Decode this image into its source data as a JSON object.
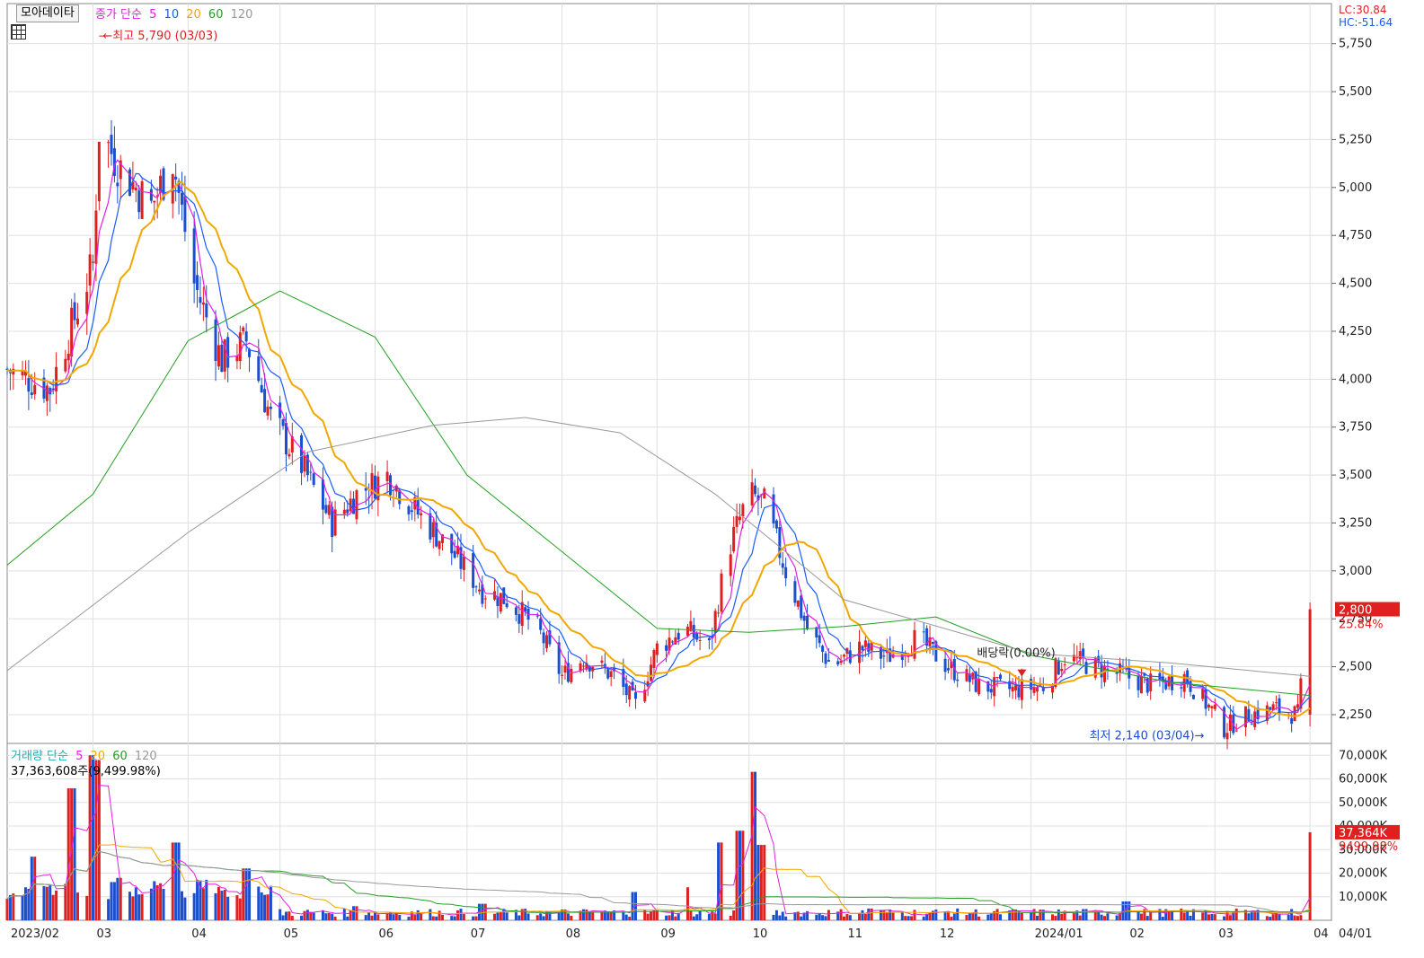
{
  "toolbar": {
    "button_label": "모아데이타"
  },
  "legend_top": {
    "label": "종가 단순",
    "periods": [
      "5",
      "10",
      "20",
      "60",
      "120"
    ]
  },
  "legend_bottom": {
    "label": "거래량 단순",
    "periods": [
      "5",
      "20",
      "60",
      "120"
    ],
    "info": "37,363,608주(9,499.98%)"
  },
  "top_right": {
    "lc": "LC:30.84",
    "hc": "HC:-51.64"
  },
  "colors": {
    "ma5": "#e020e0",
    "ma10": "#1a5cff",
    "ma20": "#f0a800",
    "ma60": "#22a022",
    "ma120": "#999999",
    "up": "#e02020",
    "down": "#1a4fd0",
    "grid": "#e0e0e0"
  },
  "chart_data": [
    {
      "type": "candlestick",
      "title": "",
      "x_tick_labels": [
        "2023/02",
        "03",
        "04",
        "05",
        "06",
        "07",
        "08",
        "09",
        "10",
        "11",
        "12",
        "2024/01",
        "02",
        "03",
        "04",
        "04/01"
      ],
      "y_tick_labels": [
        "2,250",
        "2,500",
        "2,750",
        "3,000",
        "3,250",
        "3,500",
        "3,750",
        "4,000",
        "4,250",
        "4,500",
        "4,750",
        "5,000",
        "5,250",
        "5,500",
        "5,750"
      ],
      "ylim": [
        2100,
        5800
      ],
      "annotations": {
        "high": "최고 5,790 (03/03)",
        "low": "최저 2,140 (03/04)",
        "dividend": "배당락(0.00%)",
        "last_price": "2,800",
        "last_change": "25.84%"
      },
      "close_series": [
        [
          "2023-02-01",
          4050
        ],
        [
          "2023-02-15",
          3950
        ],
        [
          "2023-03-01",
          4600
        ],
        [
          "2023-03-03",
          5300
        ],
        [
          "2023-03-10",
          5100
        ],
        [
          "2023-03-20",
          4900
        ],
        [
          "2023-03-27",
          5150
        ],
        [
          "2023-04-03",
          4500
        ],
        [
          "2023-04-12",
          4100
        ],
        [
          "2023-04-20",
          4200
        ],
        [
          "2023-04-28",
          3800
        ],
        [
          "2023-05-08",
          3550
        ],
        [
          "2023-05-18",
          3250
        ],
        [
          "2023-05-26",
          3400
        ],
        [
          "2023-06-05",
          3500
        ],
        [
          "2023-06-15",
          3300
        ],
        [
          "2023-06-26",
          3100
        ],
        [
          "2023-07-06",
          2900
        ],
        [
          "2023-07-14",
          2850
        ],
        [
          "2023-07-24",
          2700
        ],
        [
          "2023-08-01",
          2450
        ],
        [
          "2023-08-08",
          2550
        ],
        [
          "2023-08-18",
          2450
        ],
        [
          "2023-08-25",
          2300
        ],
        [
          "2023-09-01",
          2600
        ],
        [
          "2023-09-10",
          2700
        ],
        [
          "2023-09-18",
          2600
        ],
        [
          "2023-09-24",
          3100
        ],
        [
          "2023-10-01",
          3400
        ],
        [
          "2023-10-06",
          3350
        ],
        [
          "2023-10-13",
          3000
        ],
        [
          "2023-10-20",
          2700
        ],
        [
          "2023-10-28",
          2500
        ],
        [
          "2023-11-06",
          2600
        ],
        [
          "2023-11-15",
          2550
        ],
        [
          "2023-11-25",
          2650
        ],
        [
          "2023-12-05",
          2500
        ],
        [
          "2023-12-15",
          2400
        ],
        [
          "2023-12-26",
          2380
        ],
        [
          "2024-01-05",
          2400
        ],
        [
          "2024-01-12",
          2550
        ],
        [
          "2024-01-22",
          2500
        ],
        [
          "2024-02-01",
          2450
        ],
        [
          "2024-02-10",
          2400
        ],
        [
          "2024-02-20",
          2450
        ],
        [
          "2024-03-01",
          2250
        ],
        [
          "2024-03-04",
          2180
        ],
        [
          "2024-03-12",
          2250
        ],
        [
          "2024-03-20",
          2280
        ],
        [
          "2024-03-28",
          2250
        ],
        [
          "2024-04-01",
          2800
        ]
      ],
      "ma120_series": [
        [
          "2023-02-01",
          2480
        ],
        [
          "2023-04-01",
          3200
        ],
        [
          "2023-05-10",
          3620
        ],
        [
          "2023-06-20",
          3760
        ],
        [
          "2023-07-20",
          3800
        ],
        [
          "2023-08-20",
          3720
        ],
        [
          "2023-09-20",
          3400
        ],
        [
          "2023-11-01",
          2850
        ],
        [
          "2024-01-01",
          2570
        ],
        [
          "2024-02-15",
          2520
        ],
        [
          "2024-04-01",
          2450
        ]
      ],
      "ma60_series": [
        [
          "2023-02-01",
          3030
        ],
        [
          "2023-03-01",
          3400
        ],
        [
          "2023-04-01",
          4200
        ],
        [
          "2023-05-01",
          4460
        ],
        [
          "2023-06-01",
          4220
        ],
        [
          "2023-07-01",
          3500
        ],
        [
          "2023-08-01",
          3100
        ],
        [
          "2023-09-01",
          2700
        ],
        [
          "2023-10-01",
          2680
        ],
        [
          "2023-11-01",
          2710
        ],
        [
          "2023-12-01",
          2760
        ],
        [
          "2024-01-01",
          2560
        ],
        [
          "2024-02-15",
          2420
        ],
        [
          "2024-04-01",
          2350
        ]
      ]
    },
    {
      "type": "bar",
      "title": "",
      "y_tick_labels": [
        "10,000K",
        "20,000K",
        "30,000K",
        "40,000K",
        "50,000K",
        "60,000K",
        "70,000K"
      ],
      "ylim": [
        0,
        72000
      ],
      "annotations": {
        "last_volume": "37,364K",
        "last_change": "9499.98%"
      },
      "volume_spikes": [
        [
          "2023-02-10",
          27000
        ],
        [
          "2023-02-22",
          56000
        ],
        [
          "2023-03-01",
          70000
        ],
        [
          "2023-03-03",
          68000
        ],
        [
          "2023-03-10",
          18000
        ],
        [
          "2023-03-28",
          33000
        ],
        [
          "2023-04-20",
          22000
        ],
        [
          "2023-05-26",
          6000
        ],
        [
          "2023-07-06",
          7000
        ],
        [
          "2023-08-25",
          12000
        ],
        [
          "2023-09-10",
          14000
        ],
        [
          "2023-09-22",
          33000
        ],
        [
          "2023-09-28",
          38000
        ],
        [
          "2023-10-02",
          63000
        ],
        [
          "2023-10-05",
          32000
        ],
        [
          "2023-11-10",
          5000
        ],
        [
          "2024-02-01",
          8000
        ],
        [
          "2024-04-01",
          37364
        ]
      ]
    }
  ]
}
